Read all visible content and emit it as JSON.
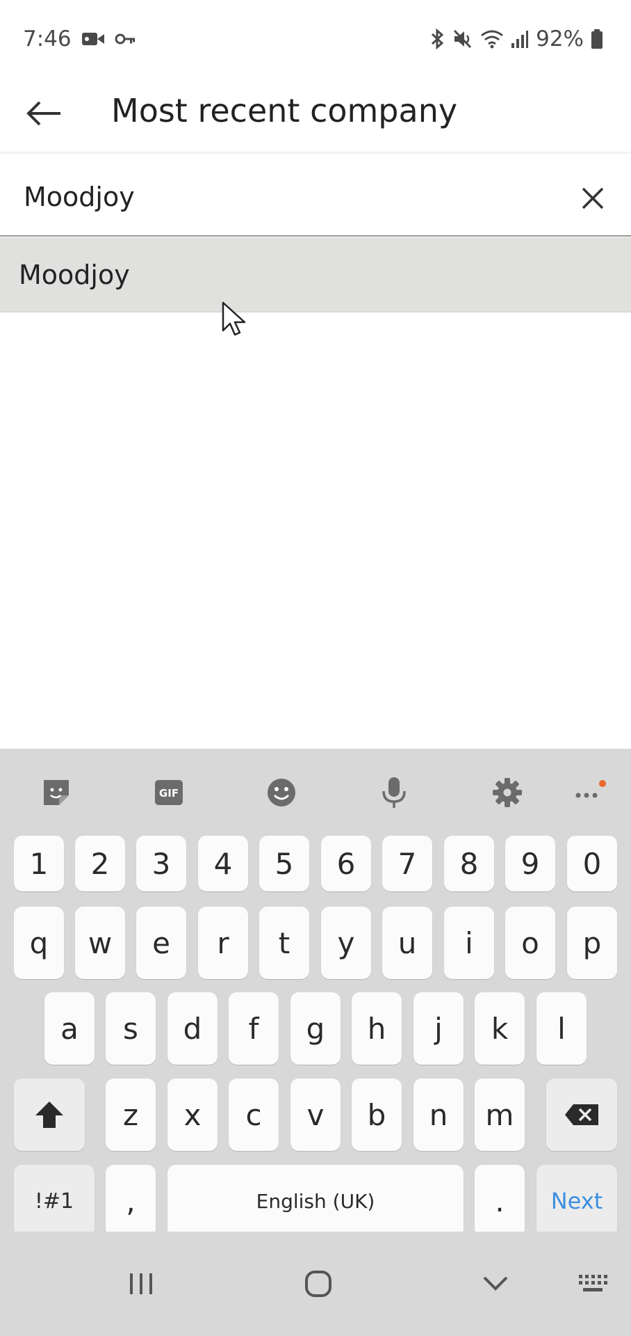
{
  "status_bar": {
    "time": "7:46",
    "battery": "92%",
    "icons_left": [
      "video-record-icon",
      "key-icon"
    ],
    "icons_right": [
      "bluetooth-icon",
      "mute-icon",
      "wifi-icon",
      "signal-icon",
      "battery-icon"
    ]
  },
  "app_bar": {
    "title": "Most recent company"
  },
  "search": {
    "value": "Moodjoy"
  },
  "suggestions": [
    {
      "label": "Moodjoy"
    }
  ],
  "keyboard": {
    "toolbar": [
      "sticker-icon",
      "gif-icon",
      "emoji-icon",
      "microphone-icon",
      "settings-icon",
      "more-icon"
    ],
    "gif_label": "GIF",
    "row_numbers": [
      "1",
      "2",
      "3",
      "4",
      "5",
      "6",
      "7",
      "8",
      "9",
      "0"
    ],
    "row_q": [
      "q",
      "w",
      "e",
      "r",
      "t",
      "y",
      "u",
      "i",
      "o",
      "p"
    ],
    "row_a": [
      "a",
      "s",
      "d",
      "f",
      "g",
      "h",
      "j",
      "k",
      "l"
    ],
    "row_z": [
      "z",
      "x",
      "c",
      "v",
      "b",
      "n",
      "m"
    ],
    "symbols_label": "!#1",
    "comma_label": ",",
    "space_label": "English (UK)",
    "period_label": ".",
    "next_label": "Next",
    "accent_color": "#3d8fe0"
  },
  "nav_bar": {
    "icons": [
      "recent-apps-icon",
      "home-icon",
      "back-down-icon",
      "keyboard-icon"
    ]
  }
}
